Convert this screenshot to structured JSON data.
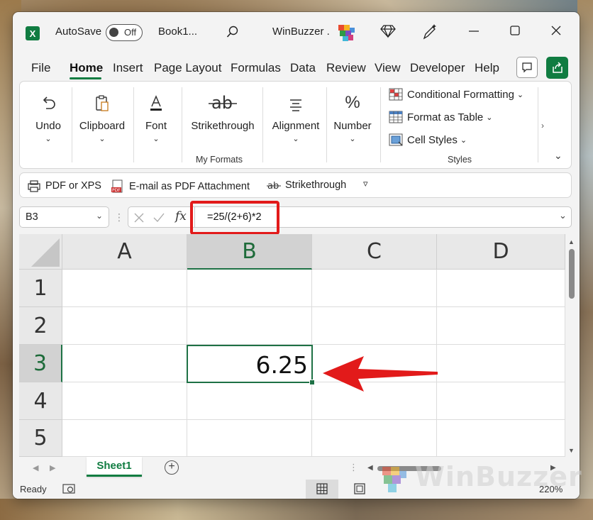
{
  "titlebar": {
    "autosave_label": "AutoSave",
    "autosave_state": "Off",
    "workbook_name": "Book1...",
    "account_name": "WinBuzzer ."
  },
  "tabs": [
    "File",
    "Home",
    "Insert",
    "Page Layout",
    "Formulas",
    "Data",
    "Review",
    "View",
    "Developer",
    "Help"
  ],
  "active_tab": "Home",
  "ribbon": {
    "undo": "Undo",
    "clipboard": "Clipboard",
    "font": "Font",
    "strikethrough": "Strikethrough",
    "my_formats_caption": "My Formats",
    "alignment": "Alignment",
    "number": "Number",
    "conditional_formatting": "Conditional Formatting",
    "format_as_table": "Format as Table",
    "cell_styles": "Cell Styles",
    "styles_caption": "Styles"
  },
  "quick_access": {
    "pdf_xps": "PDF or XPS",
    "email_pdf": "E-mail as PDF Attachment",
    "strikethrough": "Strikethrough"
  },
  "formula_bar": {
    "name_box": "B3",
    "formula": "=25/(2+6)*2",
    "fx": "fx"
  },
  "grid": {
    "columns": [
      "A",
      "B",
      "C",
      "D"
    ],
    "rows": [
      "1",
      "2",
      "3",
      "4",
      "5"
    ],
    "selected_column": "B",
    "selected_row": "3",
    "active_cell_value": "6.25"
  },
  "sheets": [
    "Sheet1"
  ],
  "status": {
    "ready": "Ready",
    "zoom": "220%"
  },
  "watermark": "WinBuzzer",
  "colors": {
    "excel_green": "#107c41",
    "annotation_red": "#e21a1a"
  }
}
